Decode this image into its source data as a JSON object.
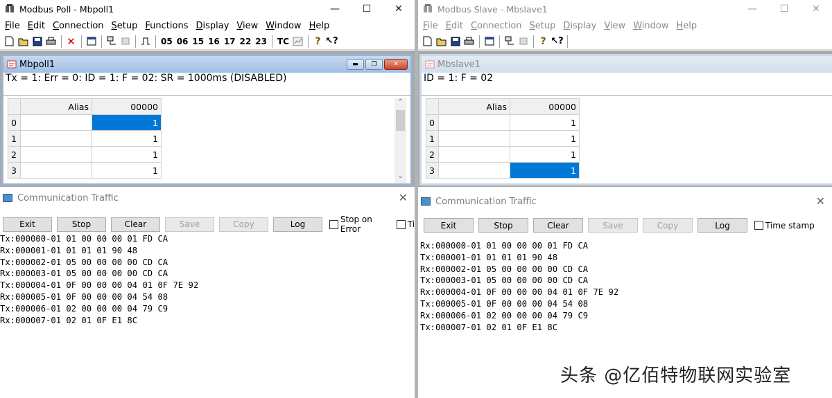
{
  "poll": {
    "title": "Modbus Poll - Mbpoll1",
    "menu": [
      {
        "u": "F",
        "rest": "ile"
      },
      {
        "u": "E",
        "rest": "dit"
      },
      {
        "u": "C",
        "rest": "onnection"
      },
      {
        "u": "S",
        "rest": "etup"
      },
      {
        "u": "F",
        "rest": "unctions"
      },
      {
        "u": "D",
        "rest": "isplay"
      },
      {
        "u": "V",
        "rest": "iew"
      },
      {
        "u": "W",
        "rest": "indow"
      },
      {
        "u": "H",
        "rest": "elp"
      }
    ],
    "function_codes": [
      "05",
      "06",
      "15",
      "16",
      "17",
      "22",
      "23"
    ],
    "tc_label": "TC",
    "child_title": "Mbpoll1",
    "status": "Tx = 1: Err = 0: ID = 1: F = 02: SR = 1000ms  (DISABLED)",
    "grid": {
      "alias_header": "Alias",
      "col_header": "00000",
      "rows": [
        {
          "n": "0",
          "v": "1"
        },
        {
          "n": "1",
          "v": "1"
        },
        {
          "n": "2",
          "v": "1"
        },
        {
          "n": "3",
          "v": "1"
        }
      ]
    },
    "traffic": {
      "title": "Communication Traffic",
      "buttons": [
        "Exit",
        "Stop",
        "Clear",
        "Save",
        "Copy",
        "Log"
      ],
      "stop_on_error": "Stop on Error",
      "time_stamp_clipped": "Ti",
      "lines": [
        "Tx:000000-01 01 00 00 00 01 FD CA",
        "Rx:000001-01 01 01 01 90 48",
        "Tx:000002-01 05 00 00 00 00 CD CA",
        "Rx:000003-01 05 00 00 00 00 CD CA",
        "Tx:000004-01 0F 00 00 00 04 01 0F 7E 92",
        "Rx:000005-01 0F 00 00 00 04 54 08",
        "Tx:000006-01 02 00 00 00 04 79 C9",
        "Rx:000007-01 02 01 0F E1 8C"
      ]
    }
  },
  "slave": {
    "title": "Modbus Slave - Mbslave1",
    "menu": [
      {
        "u": "F",
        "rest": "ile"
      },
      {
        "u": "E",
        "rest": "dit"
      },
      {
        "u": "C",
        "rest": "onnection"
      },
      {
        "u": "S",
        "rest": "etup"
      },
      {
        "u": "D",
        "rest": "isplay"
      },
      {
        "u": "V",
        "rest": "iew"
      },
      {
        "u": "W",
        "rest": "indow"
      },
      {
        "u": "H",
        "rest": "elp"
      }
    ],
    "child_title": "Mbslave1",
    "status": "ID = 1: F = 02",
    "grid": {
      "alias_header": "Alias",
      "col_header": "00000",
      "rows": [
        {
          "n": "0",
          "v": "1"
        },
        {
          "n": "1",
          "v": "1"
        },
        {
          "n": "2",
          "v": "1"
        },
        {
          "n": "3",
          "v": "1"
        }
      ]
    },
    "traffic": {
      "title": "Communication Traffic",
      "buttons": [
        "Exit",
        "Stop",
        "Clear",
        "Save",
        "Copy",
        "Log"
      ],
      "time_stamp": "Time stamp",
      "lines": [
        "Rx:000000-01 01 00 00 00 01 FD CA",
        "Tx:000001-01 01 01 01 90 48",
        "Rx:000002-01 05 00 00 00 00 CD CA",
        "Tx:000003-01 05 00 00 00 00 CD CA",
        "Rx:000004-01 0F 00 00 00 04 01 0F 7E 92",
        "Tx:000005-01 0F 00 00 00 04 54 08",
        "Rx:000006-01 02 00 00 00 04 79 C9",
        "Tx:000007-01 02 01 0F E1 8C"
      ]
    }
  },
  "watermark": "头条 @亿佰特物联网实验室"
}
